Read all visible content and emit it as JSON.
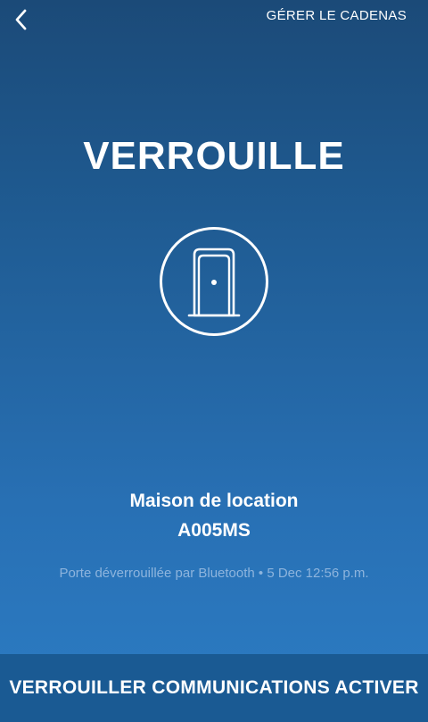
{
  "header": {
    "back_icon": "chevron-left-icon",
    "manage_label": "GÉRER LE CADENAS"
  },
  "status": {
    "title": "VERROUILLE",
    "icon": "door-icon"
  },
  "lock": {
    "name": "Maison de location",
    "id": "A005MS",
    "last_event": "Porte déverrouillée par Bluetooth • 5 Dec 12:56 p.m."
  },
  "footer": {
    "action_label": "VERROUILLER COMMUNICATIONS ACTIVER"
  },
  "colors": {
    "background_top": "#1b4a78",
    "background_bottom": "#2c7cc4",
    "footer_bar": "#1a5a93",
    "muted_text": "#8db4dd"
  }
}
